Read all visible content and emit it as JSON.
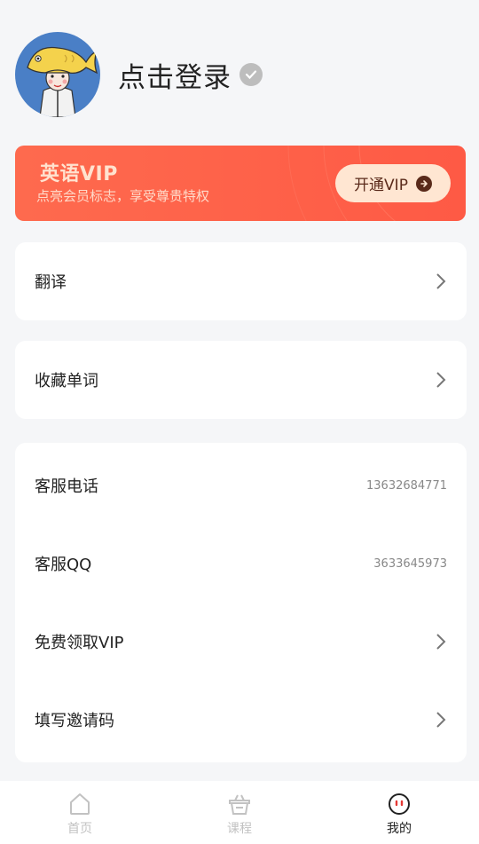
{
  "profile": {
    "login_text": "点击登录",
    "avatar_icon": "fish-hat-avatar",
    "verify_icon": "check-badge-icon"
  },
  "vip": {
    "title": "英语VIP",
    "subtitle": "点亮会员标志，享受尊贵特权",
    "button_label": "开通VIP",
    "accent": "#fe5c47"
  },
  "menu1": {
    "label": "翻译"
  },
  "menu2": {
    "label": "收藏单词"
  },
  "contact": {
    "items": [
      {
        "label": "客服电话",
        "value": "13632684771"
      },
      {
        "label": "客服QQ",
        "value": "3633645973"
      },
      {
        "label": "免费领取VIP"
      },
      {
        "label": "填写邀请码"
      }
    ]
  },
  "tabbar": {
    "tabs": [
      {
        "label": "首页",
        "icon": "home-icon"
      },
      {
        "label": "课程",
        "icon": "basket-icon"
      },
      {
        "label": "我的",
        "icon": "face-icon",
        "active": true
      }
    ]
  }
}
